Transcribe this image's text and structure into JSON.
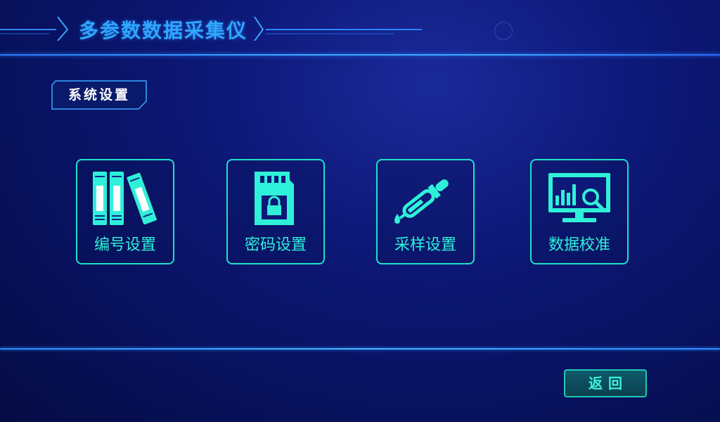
{
  "app": {
    "title": "多参数数据采集仪"
  },
  "section": {
    "label": "系统设置"
  },
  "tiles": [
    {
      "label": "编号设置",
      "icon": "books-icon"
    },
    {
      "label": "密码设置",
      "icon": "sd-card-lock-icon"
    },
    {
      "label": "采样设置",
      "icon": "dropper-icon"
    },
    {
      "label": "数据校准",
      "icon": "monitor-chart-search-icon"
    }
  ],
  "footer": {
    "back_label": "返回"
  },
  "colors": {
    "accent_teal": "#1fe0c8",
    "title_blue": "#2fa7ff",
    "background": "#0d1878"
  }
}
